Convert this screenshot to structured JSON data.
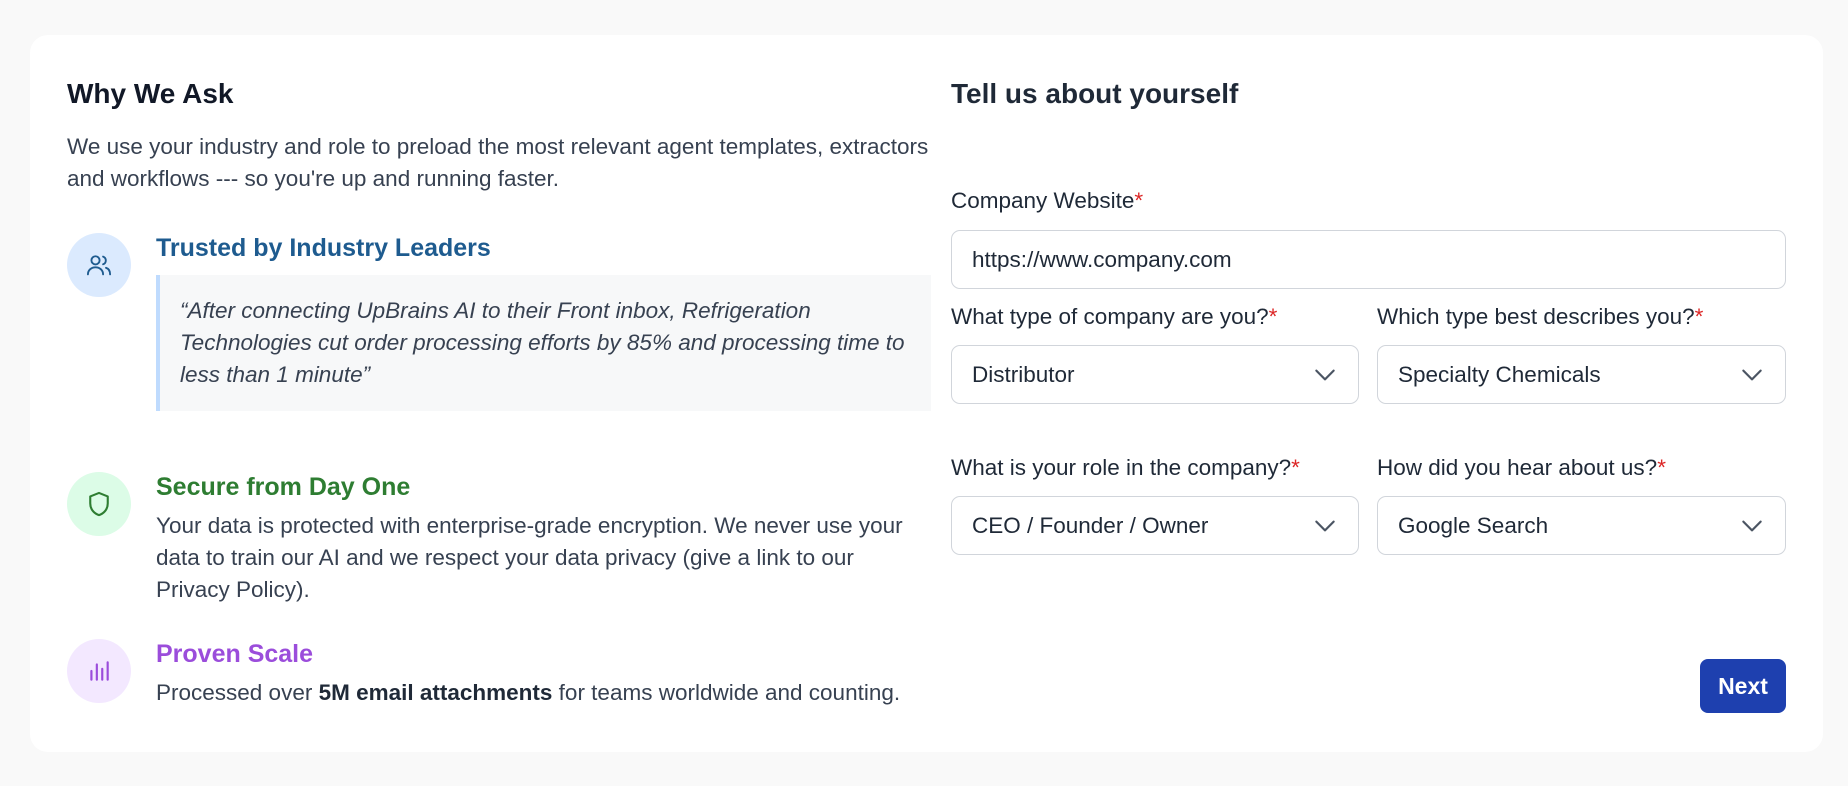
{
  "left": {
    "title": "Why We Ask",
    "intro": "We use your industry and role to preload the most relevant agent templates, extractors and workflows --- so you're up and running faster.",
    "features": [
      {
        "icon": "users-icon",
        "title": "Trusted by Industry Leaders",
        "title_color": "#1e5b8f",
        "quote": "“After connecting UpBrains AI to their Front inbox, Refrigeration Technologies cut order processing efforts by 85% and processing time to less than 1 minute”"
      },
      {
        "icon": "shield-icon",
        "title": "Secure from Day One",
        "title_color": "#2e7d32",
        "text": "Your data is protected with enterprise-grade encryption. We never use your data to train our AI and we respect your data privacy (give a link to our Privacy Policy)."
      },
      {
        "icon": "bar-chart-icon",
        "title": "Proven Scale",
        "title_color": "#9b4ddb",
        "text_before": "Processed over ",
        "text_bold": "5M email attachments",
        "text_after": " for teams worldwide and counting."
      }
    ]
  },
  "form": {
    "title": "Tell us about yourself",
    "required_mark": "*",
    "website": {
      "label": "Company Website",
      "value": "https://www.company.com"
    },
    "company_type": {
      "label": "What type of company are you?",
      "value": "Distributor"
    },
    "describes": {
      "label": "Which type best describes you?",
      "value": "Specialty Chemicals"
    },
    "role": {
      "label": "What is your role in the company?",
      "value": "CEO / Founder / Owner"
    },
    "heard": {
      "label": "How did you hear about us?",
      "value": "Google Search"
    },
    "next_label": "Next"
  },
  "colors": {
    "accent": "#1e40af",
    "required": "#dc2626"
  }
}
